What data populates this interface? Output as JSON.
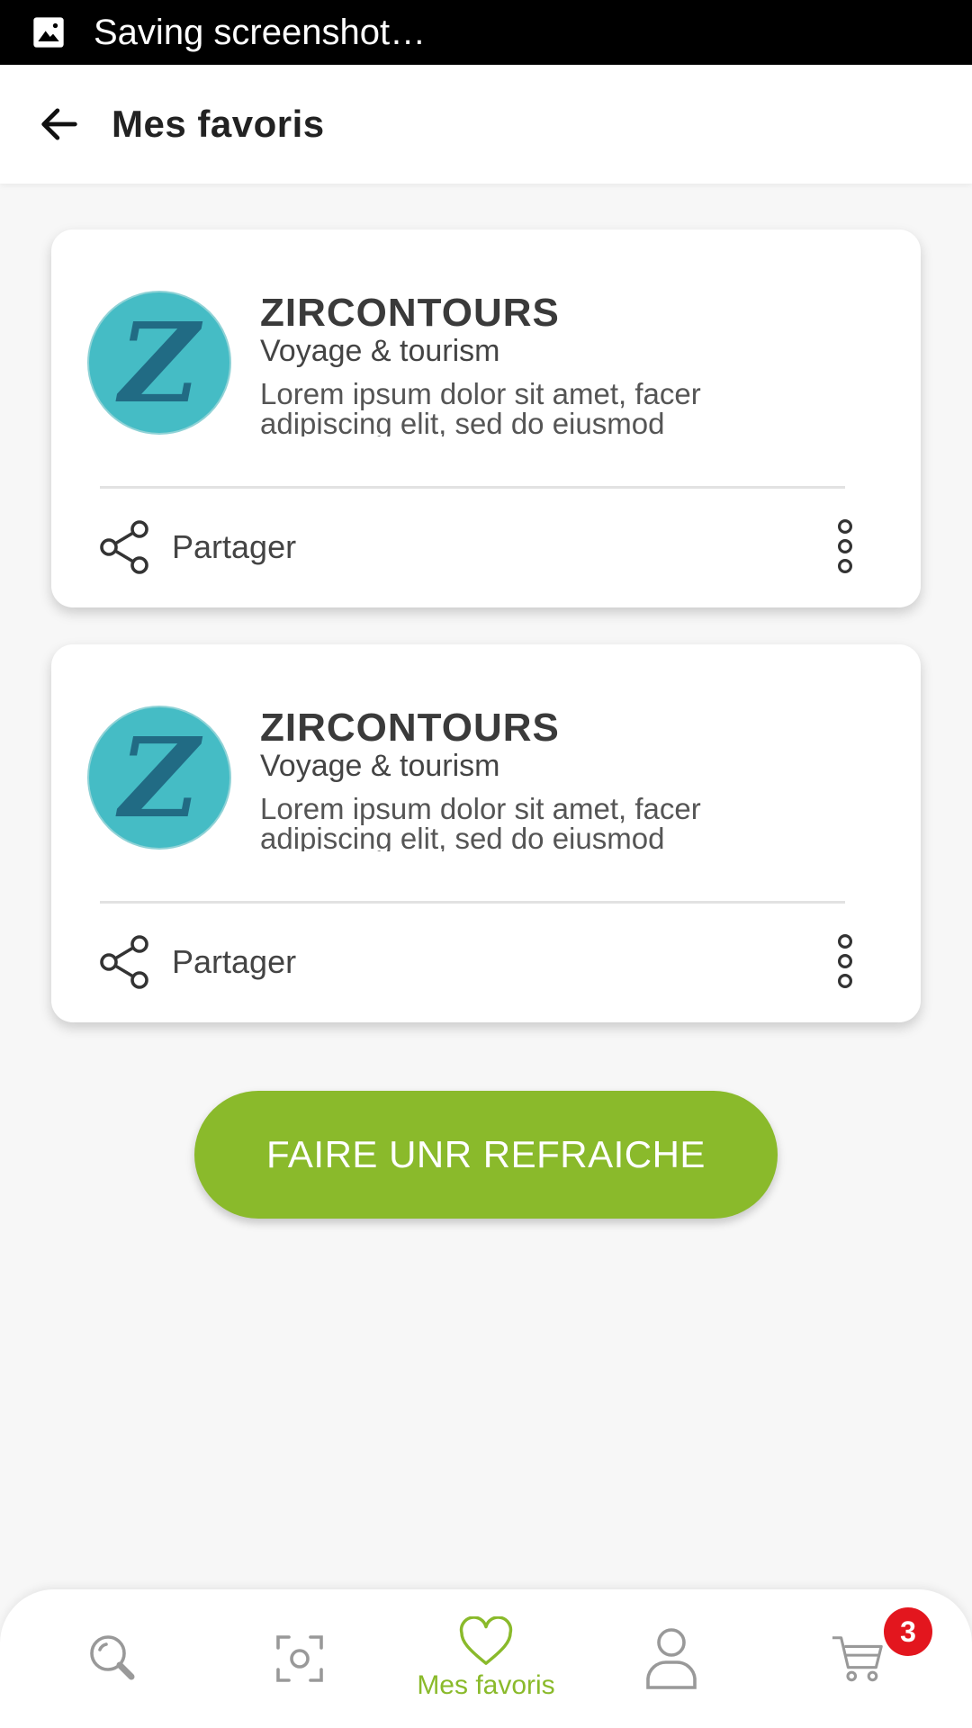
{
  "status_bar": {
    "notification_text": "Saving screenshot…",
    "icon": "image-icon"
  },
  "header": {
    "title": "Mes favoris",
    "back_icon": "arrow-left-icon"
  },
  "favorites": [
    {
      "name": "ZIRCONTOURS",
      "category": "Voyage & tourism",
      "description": "Lorem ipsum dolor sit amet, facer adipiscing elit, sed do eiusmod",
      "logo_letter": "Z",
      "share_label": "Partager"
    },
    {
      "name": "ZIRCONTOURS",
      "category": "Voyage & tourism",
      "description": "Lorem ipsum dolor sit amet, facer adipiscing elit, sed do eiusmod",
      "logo_letter": "Z",
      "share_label": "Partager"
    }
  ],
  "refresh_button": {
    "label": "FAIRE UNR REFRAICHE"
  },
  "bottom_nav": {
    "items": [
      {
        "icon": "search-icon",
        "label": "",
        "active": false
      },
      {
        "icon": "scan-icon",
        "label": "",
        "active": false
      },
      {
        "icon": "heart-icon",
        "label": "Mes favoris",
        "active": true
      },
      {
        "icon": "user-icon",
        "label": "",
        "active": false
      },
      {
        "icon": "cart-icon",
        "label": "",
        "active": false,
        "badge": "3"
      }
    ]
  },
  "colors": {
    "accent": "#8aba2b",
    "logo_bg": "#45bcc5",
    "badge": "#e3161e",
    "status_bar": "#000000"
  }
}
